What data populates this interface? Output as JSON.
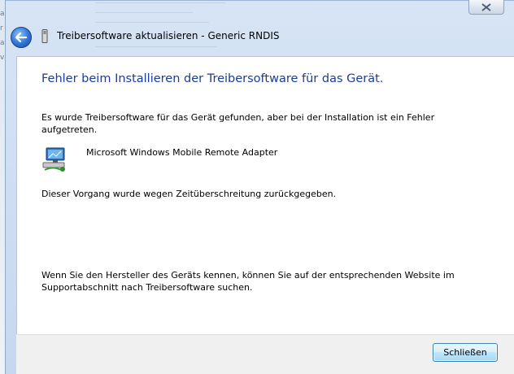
{
  "window": {
    "title": "Treibersoftware aktualisieren - Generic RNDIS"
  },
  "content": {
    "heading": "Fehler beim Installieren der Treibersoftware für das Gerät.",
    "found_message": "Es wurde Treibersoftware für das Gerät gefunden, aber bei der Installation ist ein Fehler aufgetreten.",
    "device_name": "Microsoft Windows Mobile Remote Adapter",
    "timeout_message": "Dieser Vorgang wurde wegen Zeitüberschreitung zurückgegeben.",
    "hint_message": "Wenn Sie den Hersteller des Geräts kennen, können Sie auf der entsprechenden Website im Supportabschnitt nach Treibersoftware suchen."
  },
  "footer": {
    "close_label": "Schließen"
  },
  "background": {
    "partial_texts": [
      "a",
      "r",
      "a",
      "v"
    ]
  },
  "colors": {
    "heading": "#1a3d9a",
    "accent_button": "#3c7fb1"
  }
}
